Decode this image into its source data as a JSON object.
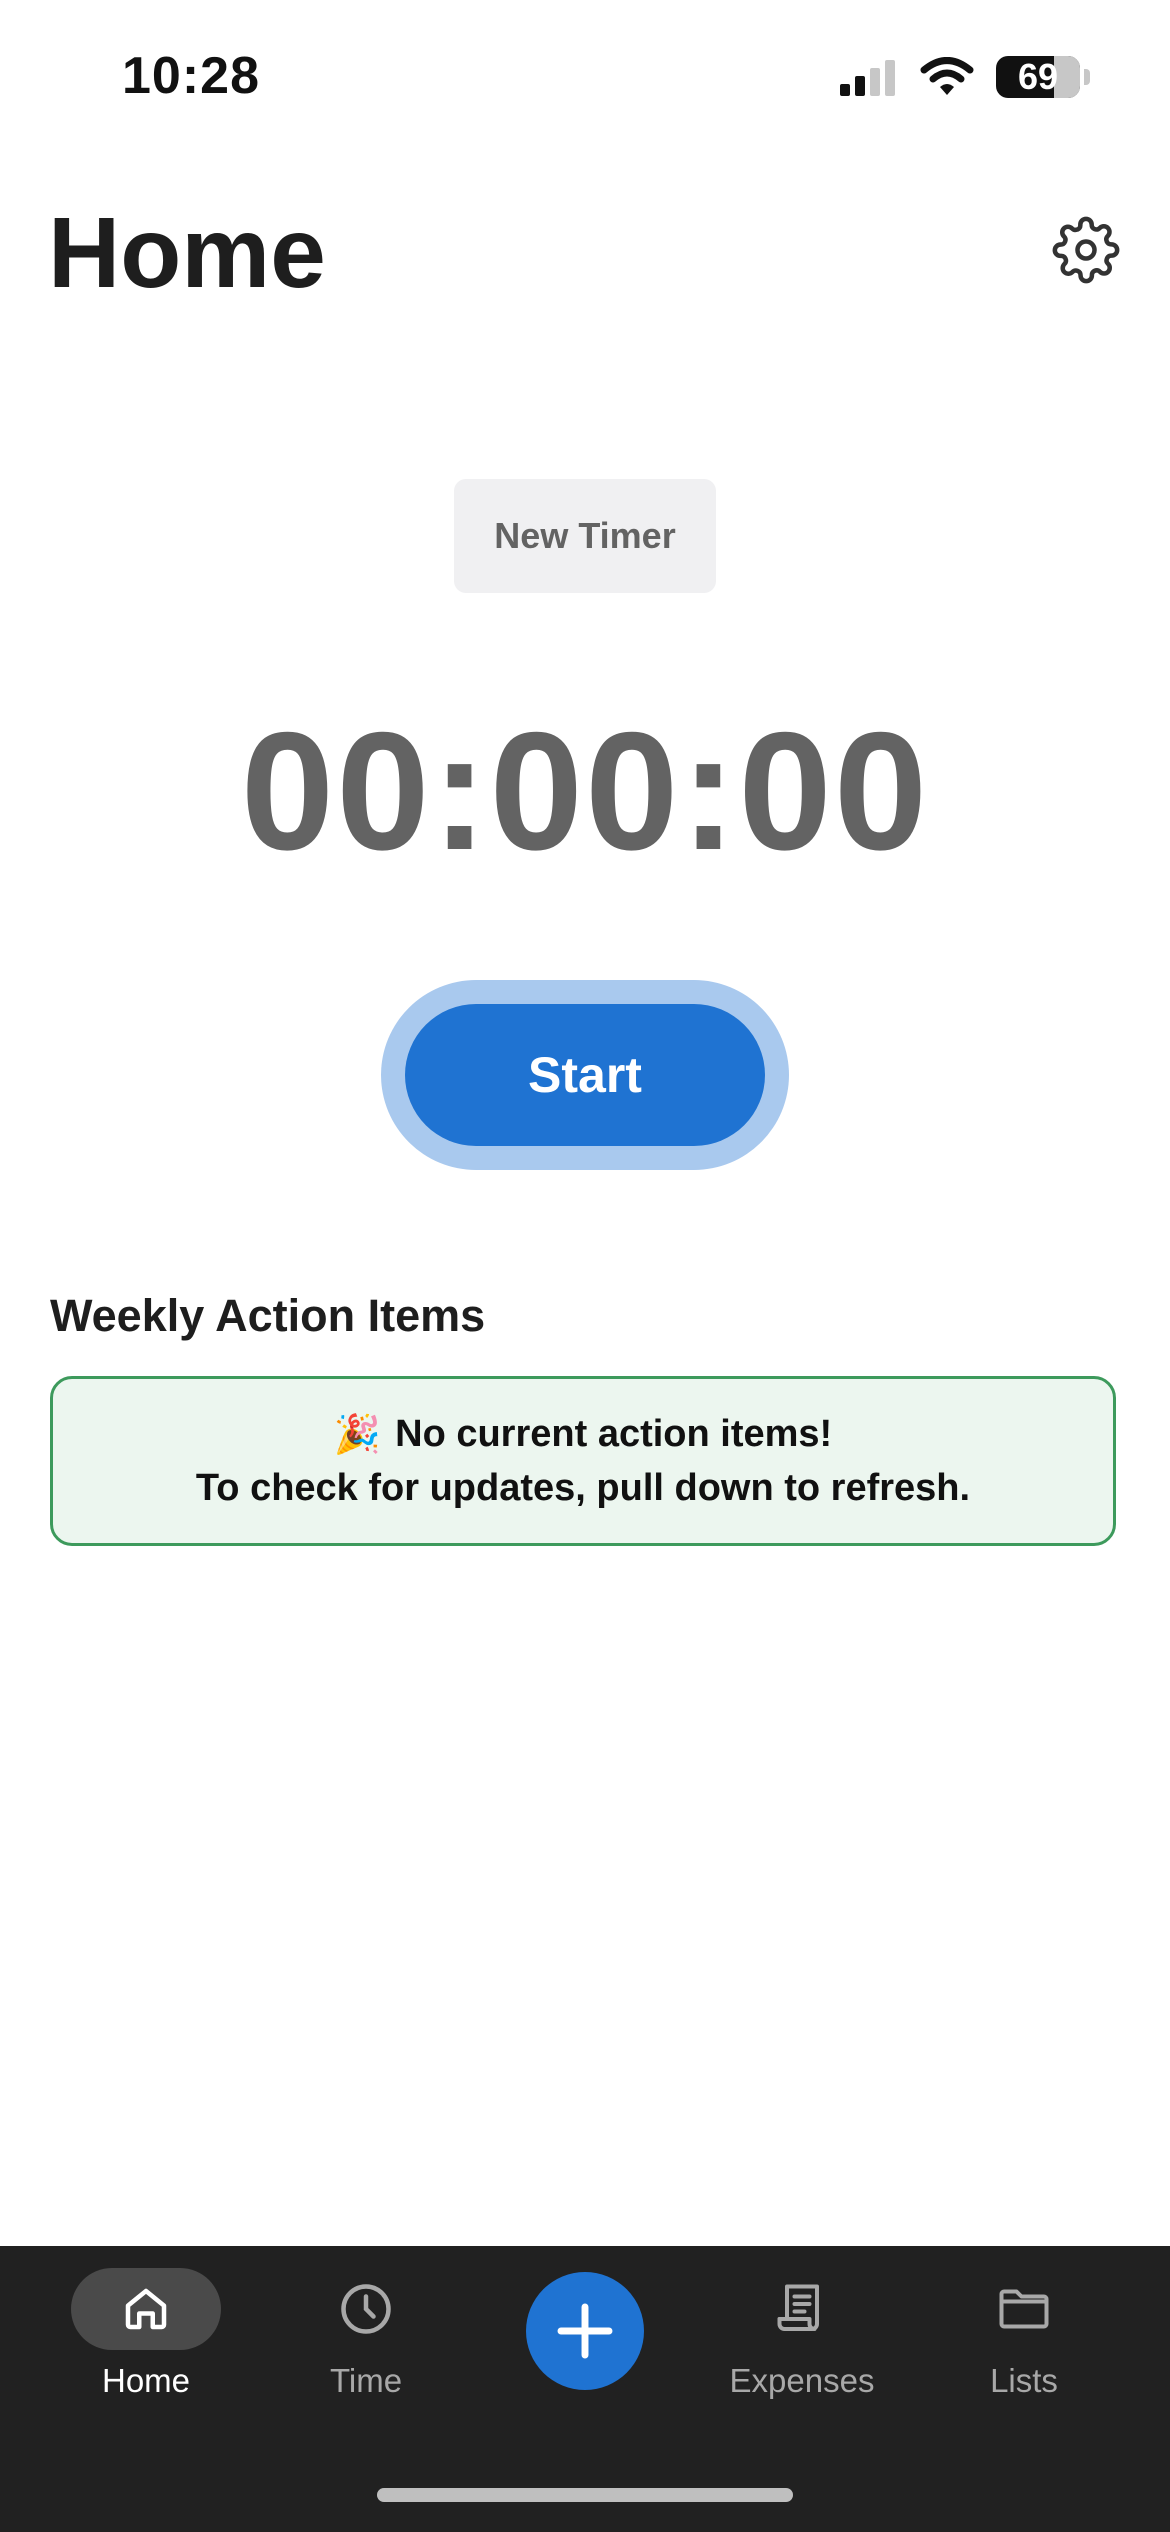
{
  "status_bar": {
    "time": "10:28",
    "battery_percent": "69",
    "battery_level": 0.69,
    "icons": [
      "cellular-signal-icon",
      "wifi-icon",
      "battery-icon"
    ]
  },
  "header": {
    "title": "Home",
    "settings_icon": "gear-icon"
  },
  "timer": {
    "new_timer_label": "New Timer",
    "display": "00:00:00",
    "start_label": "Start"
  },
  "weekly": {
    "title": "Weekly Action Items",
    "empty_emoji": "🎉",
    "empty_title": "No current action items!",
    "empty_subtitle": "To check for updates, pull down to refresh."
  },
  "tab_bar": {
    "items": [
      {
        "label": "Home",
        "icon": "house-icon",
        "active": true
      },
      {
        "label": "Time",
        "icon": "clock-icon",
        "active": false
      },
      {
        "label": "",
        "icon": "plus-icon",
        "active": false
      },
      {
        "label": "Expenses",
        "icon": "receipt-icon",
        "active": false
      },
      {
        "label": "Lists",
        "icon": "folder-icon",
        "active": false
      }
    ]
  },
  "colors": {
    "accent": "#1f73d2",
    "accent_halo": "#a9c9ee",
    "success_border": "#3d9a5c",
    "success_bg": "#ecf6ef",
    "tab_bar_bg": "#212121"
  }
}
